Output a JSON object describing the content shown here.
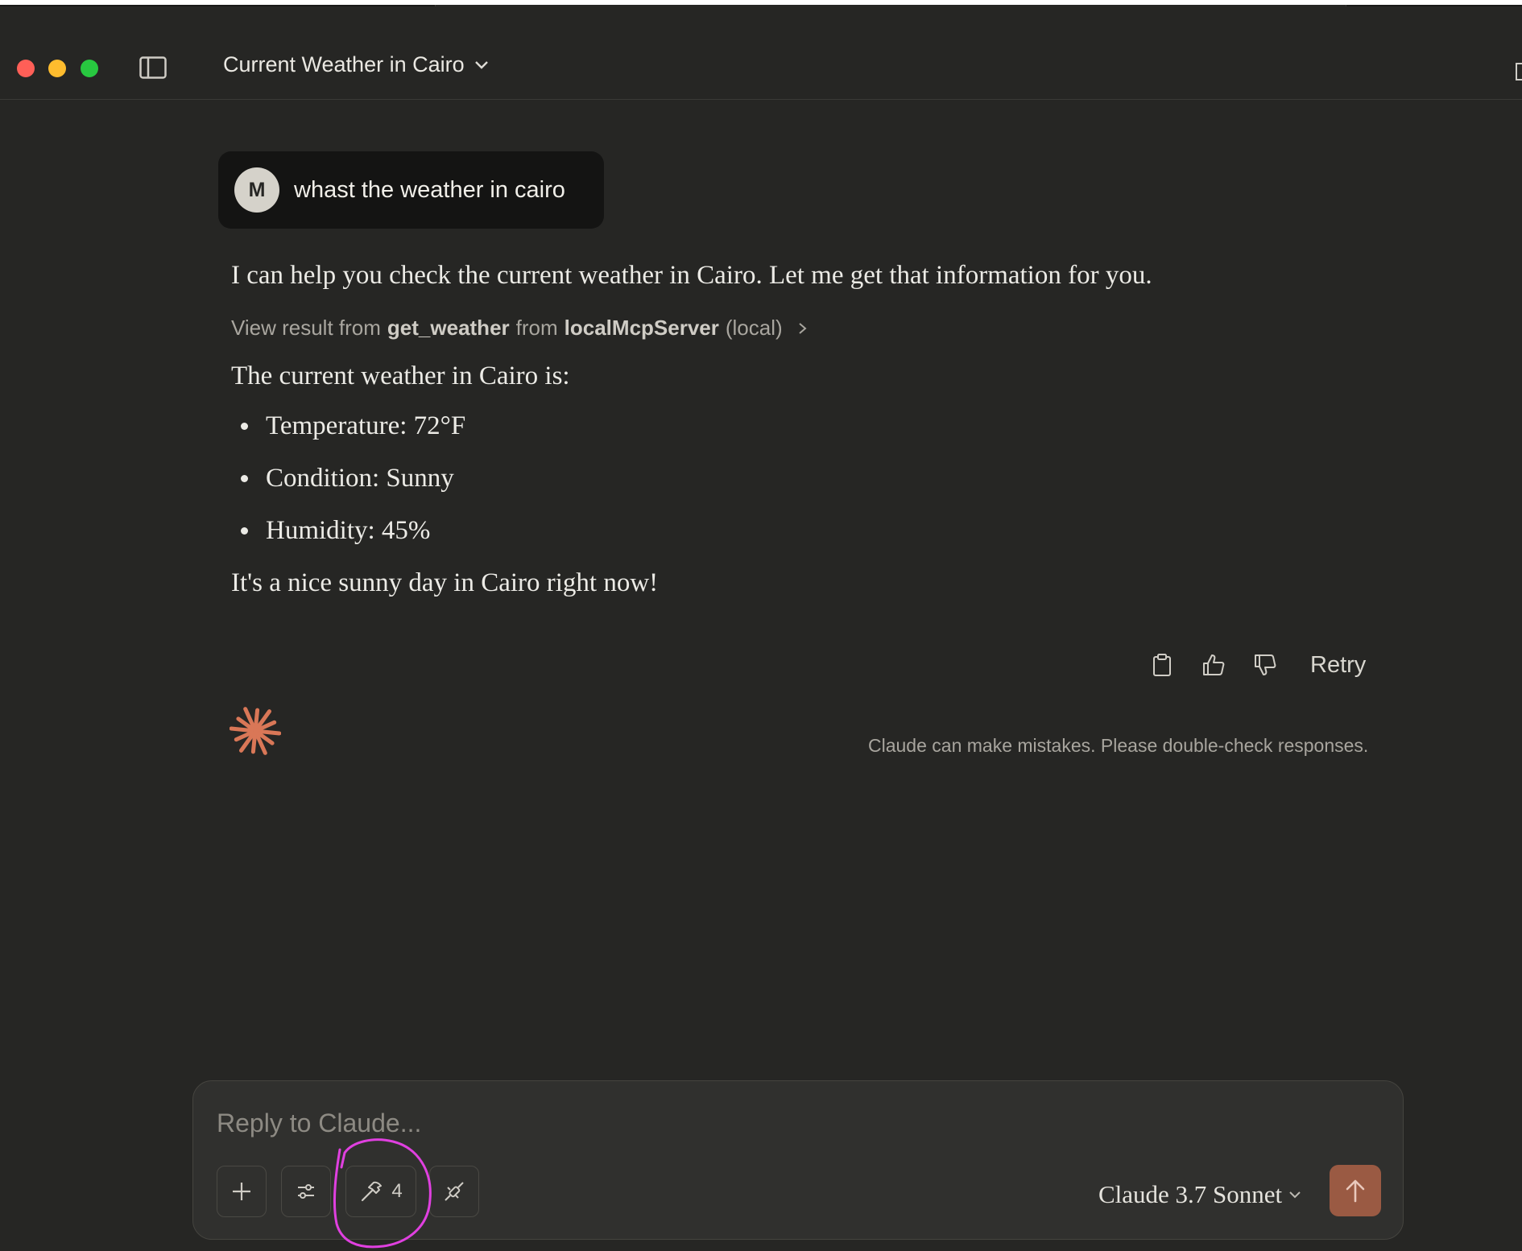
{
  "window": {
    "conversation_title": "Current Weather in Cairo"
  },
  "user_message": {
    "avatar_initial": "M",
    "text": "whast the weather in cairo"
  },
  "assistant": {
    "intro": "I can help you check the current weather in Cairo. Let me get that information for you.",
    "tool_result": {
      "prefix": "View result from",
      "tool": "get_weather",
      "from": "from",
      "server": "localMcpServer",
      "scope": "(local)"
    },
    "lead": "The current weather in Cairo is:",
    "bullets": [
      "Temperature: 72°F",
      "Condition: Sunny",
      "Humidity: 45%"
    ],
    "closing": "It's a nice sunny day in Cairo right now!"
  },
  "actions": {
    "retry_label": "Retry"
  },
  "disclaimer": "Claude can make mistakes. Please double-check responses.",
  "composer": {
    "placeholder": "Reply to Claude...",
    "tools_count": "4",
    "model_label": "Claude 3.7 Sonnet"
  },
  "colors": {
    "accent": "#d97757",
    "send_button": "#9a5a43",
    "annotation": "#e040e0"
  },
  "icons": [
    "sidebar-toggle-icon",
    "chevron-down-icon",
    "chevron-right-icon",
    "copy-icon",
    "thumbs-up-icon",
    "thumbs-down-icon",
    "claude-spark-icon",
    "plus-icon",
    "sliders-icon",
    "hammer-icon",
    "plug-icon",
    "arrow-up-icon"
  ]
}
